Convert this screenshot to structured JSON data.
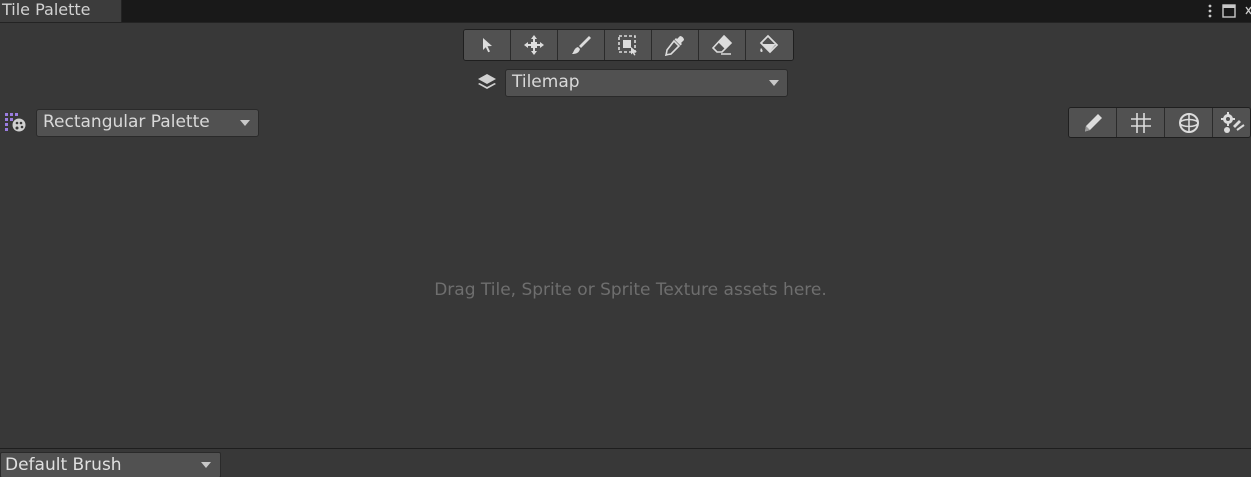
{
  "window": {
    "tab_title": "Tile Palette",
    "controls": [
      "more-options-icon",
      "maximize-icon",
      "close-icon"
    ]
  },
  "tools": [
    {
      "name": "select-tool",
      "icon": "pointer-icon"
    },
    {
      "name": "move-tool",
      "icon": "move-arrows-icon"
    },
    {
      "name": "paint-tool",
      "icon": "brush-icon"
    },
    {
      "name": "box-fill-tool",
      "icon": "box-select-icon"
    },
    {
      "name": "pick-tool",
      "icon": "eyedropper-icon"
    },
    {
      "name": "erase-tool",
      "icon": "eraser-icon"
    },
    {
      "name": "flood-fill-tool",
      "icon": "paint-bucket-icon"
    }
  ],
  "active_tilemap": {
    "icon": "layers-icon",
    "value": "Tilemap"
  },
  "palette": {
    "icon": "palette-icon",
    "value": "Rectangular Palette"
  },
  "palette_tools": [
    {
      "name": "edit-palette-button",
      "icon": "pencil-icon"
    },
    {
      "name": "grid-toggle-button",
      "icon": "grid-icon"
    },
    {
      "name": "gizmos-toggle-button",
      "icon": "gizmo-icon"
    },
    {
      "name": "palette-settings-button",
      "icon": "settings-icon"
    }
  ],
  "drop_area": {
    "message": "Drag Tile, Sprite or Sprite Texture assets here."
  },
  "brush": {
    "value": "Default Brush"
  },
  "colors": {
    "background": "#383838",
    "tabbar": "#191919",
    "button": "#515151",
    "icon": "#d6d6d6",
    "accent_purple": "#9b7de0"
  }
}
